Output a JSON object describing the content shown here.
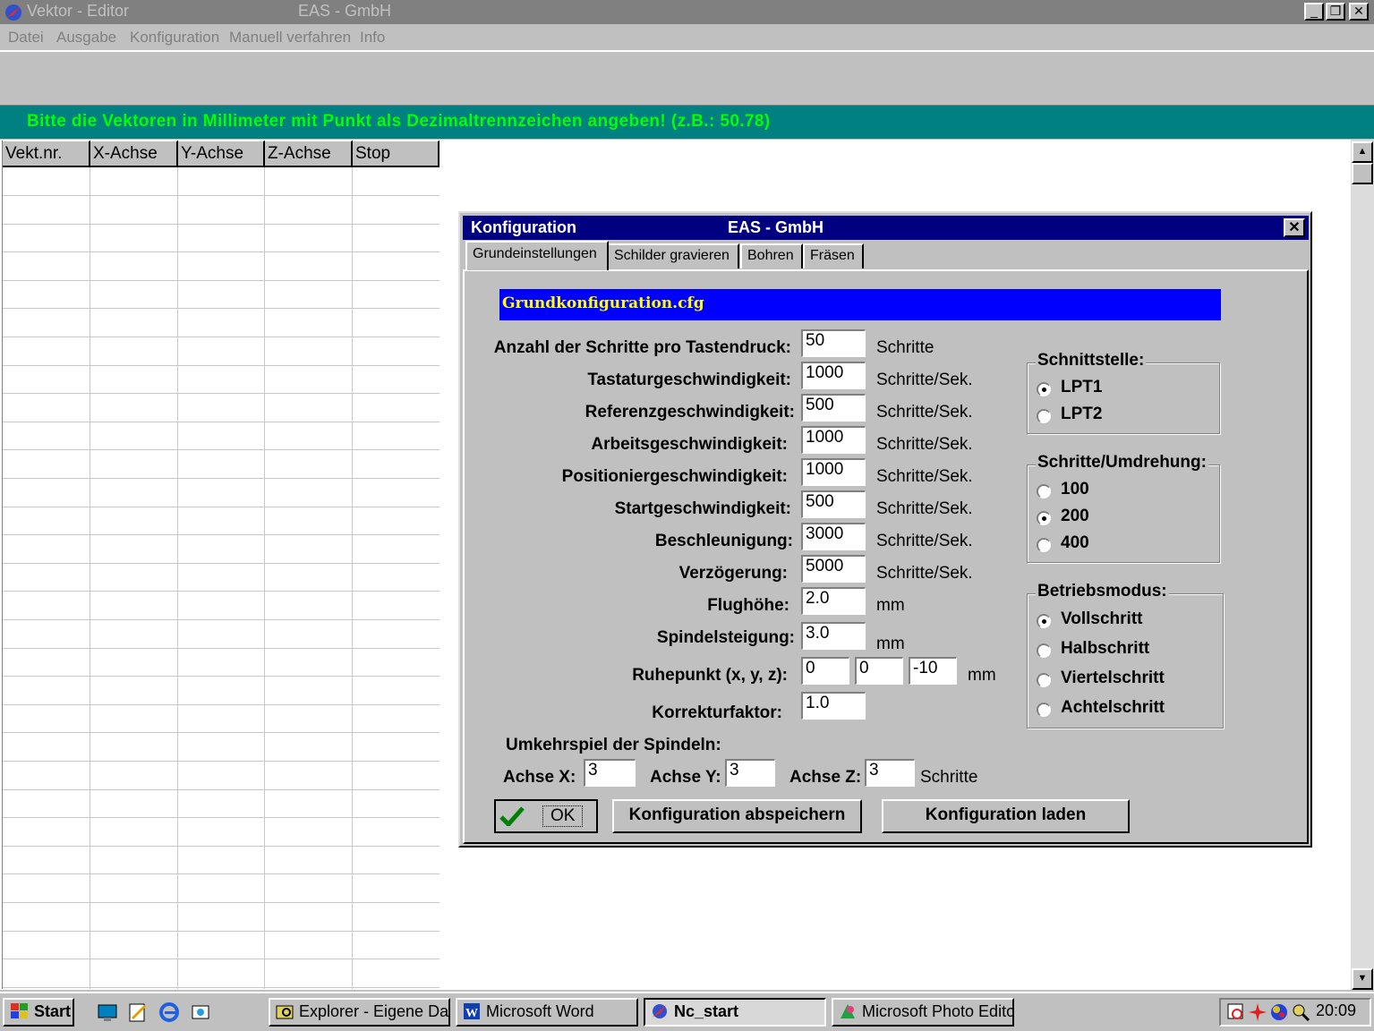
{
  "window": {
    "title": "Vektor - Editor",
    "company": "EAS - GmbH"
  },
  "menu": [
    "Datei",
    "Ausgabe",
    "Konfiguration",
    "Manuell verfahren",
    "Info"
  ],
  "hint": "Bitte die Vektoren in Millimeter mit Punkt als Dezimaltrennzeichen angeben!  (z.B.:  50.78)",
  "grid": {
    "columns": [
      "Vekt.nr.",
      "X-Achse",
      "Y-Achse",
      "Z-Achse",
      "Stop"
    ]
  },
  "dialog": {
    "title": "Konfiguration",
    "company": "EAS - GmbH",
    "tabs": [
      "Grundeinstellungen",
      "Schilder gravieren",
      "Bohren",
      "Fräsen"
    ],
    "filename": "Grundkonfiguration.cfg",
    "fields": [
      {
        "label": "Anzahl der Schritte pro Tastendruck:",
        "value": "50",
        "unit": "Schritte"
      },
      {
        "label": "Tastaturgeschwindigkeit:",
        "value": "1000",
        "unit": "Schritte/Sek."
      },
      {
        "label": "Referenzgeschwindigkeit:",
        "value": "500",
        "unit": "Schritte/Sek."
      },
      {
        "label": "Arbeitsgeschwindigkeit:",
        "value": "1000",
        "unit": "Schritte/Sek."
      },
      {
        "label": "Positioniergeschwindigkeit:",
        "value": "1000",
        "unit": "Schritte/Sek."
      },
      {
        "label": "Startgeschwindigkeit:",
        "value": "500",
        "unit": "Schritte/Sek."
      },
      {
        "label": "Beschleunigung:",
        "value": "3000",
        "unit": "Schritte/Sek."
      },
      {
        "label": "Verzögerung:",
        "value": "5000",
        "unit": "Schritte/Sek."
      },
      {
        "label": "Flughöhe:",
        "value": "2.0",
        "unit": "mm"
      },
      {
        "label": "Spindelsteigung:",
        "value": "3.0",
        "unit": "mm"
      }
    ],
    "ruhepunkt": {
      "label": "Ruhepunkt (x, y, z):",
      "x": "0",
      "y": "0",
      "z": "-10",
      "unit": "mm"
    },
    "korrektur": {
      "label": "Korrekturfaktor:",
      "value": "1.0"
    },
    "umkehrspiel": {
      "heading": "Umkehrspiel der Spindeln:",
      "x_label": "Achse X:",
      "x": "3",
      "y_label": "Achse Y:",
      "y": "3",
      "z_label": "Achse Z:",
      "z": "3",
      "unit": "Schritte"
    },
    "schnittstelle": {
      "title": "Schnittstelle:",
      "options": [
        "LPT1",
        "LPT2"
      ],
      "selected": "LPT1"
    },
    "schritte_umdrehung": {
      "title": "Schritte/Umdrehung:",
      "options": [
        "100",
        "200",
        "400"
      ],
      "selected": "200"
    },
    "betriebsmodus": {
      "title": "Betriebsmodus:",
      "options": [
        "Vollschritt",
        "Halbschritt",
        "Viertelschritt",
        "Achtelschritt"
      ],
      "selected": "Vollschritt"
    },
    "buttons": {
      "ok": "OK",
      "save": "Konfiguration abspeichern",
      "load": "Konfiguration laden"
    }
  },
  "taskbar": {
    "start": "Start",
    "tasks": [
      "Explorer - Eigene Dat...",
      "Microsoft Word",
      "Nc_start",
      "Microsoft Photo Editor"
    ],
    "active_task": "Nc_start",
    "clock": "20:09"
  },
  "colors": {
    "title_active": "#000080",
    "hint_bg": "#008080",
    "hint_text": "#00ff00",
    "file_bg": "#0000ff",
    "file_text": "#ffff00"
  }
}
